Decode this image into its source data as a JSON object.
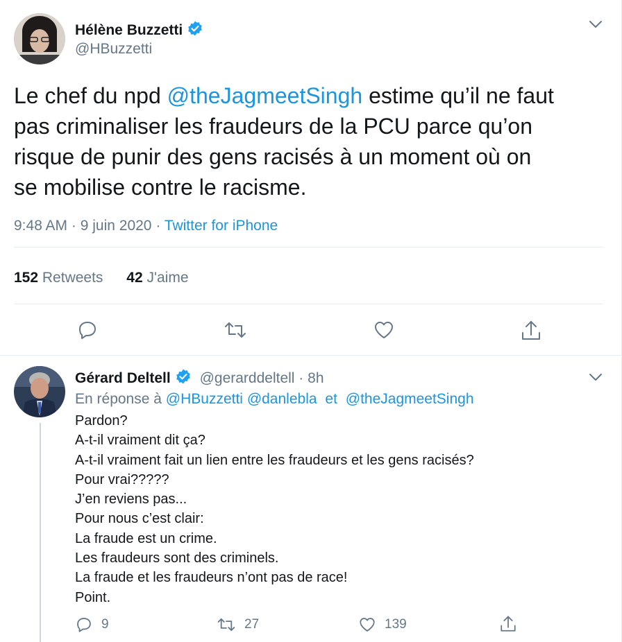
{
  "main_tweet": {
    "author_name": "Hélène Buzzetti",
    "author_handle": "@HBuzzetti",
    "text_before": "Le chef du npd ",
    "mention": "@theJagmeetSingh",
    "text_line1_after": " estime qu’il ne faut",
    "text_line2": "pas criminaliser les fraudeurs de la PCU parce qu’on",
    "text_line3": "risque de punir des gens racisés à un moment où on",
    "text_line4": "se mobilise contre le racisme.",
    "time": "9:48 AM",
    "date": "9 juin 2020",
    "source": "Twitter for iPhone",
    "retweets_count": "152",
    "retweets_label": "Retweets",
    "likes_count": "42",
    "likes_label": "J'aime"
  },
  "reply": {
    "author_name": "Gérard Deltell",
    "author_handle": "@gerarddeltell",
    "age": "8h",
    "in_reply_prefix": "En réponse à",
    "in_reply_mention1": "@HBuzzetti",
    "in_reply_mention2": "@danlebla",
    "in_reply_and": "et",
    "in_reply_mention3": "@theJagmeetSingh",
    "lines": [
      "Pardon?",
      "A-t-il vraiment dit ça?",
      "A-t-il vraiment fait un lien entre les fraudeurs et les gens racisés?",
      "Pour vrai?????",
      "J’en reviens pas...",
      "Pour nous c’est clair:",
      "La fraude est un crime.",
      "Les fraudeurs sont des criminels.",
      "La fraude et les fraudeurs n’ont pas de race!",
      "Point."
    ],
    "reply_count": "9",
    "retweet_count": "27",
    "like_count": "139"
  },
  "colors": {
    "link": "#1b95e0",
    "secondary_text": "#657786",
    "verified": "#1da1f2"
  }
}
